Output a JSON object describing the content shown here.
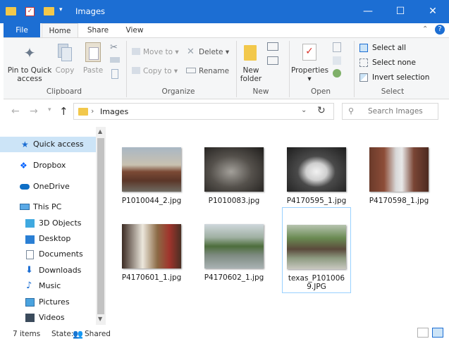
{
  "window": {
    "title": "Images"
  },
  "ribbon_tabs": [
    "File",
    "Home",
    "Share",
    "View"
  ],
  "clipboard": {
    "pin_label": "Pin to Quick access",
    "copy_label": "Copy",
    "paste_label": "Paste",
    "group_label": "Clipboard"
  },
  "organize": {
    "move_to": "Move to",
    "copy_to": "Copy to",
    "delete": "Delete",
    "rename": "Rename",
    "group_label": "Organize"
  },
  "new": {
    "new_folder": "New folder",
    "group_label": "New"
  },
  "open": {
    "properties": "Properties",
    "group_label": "Open"
  },
  "select": {
    "select_all": "Select all",
    "select_none": "Select none",
    "invert": "Invert selection",
    "group_label": "Select"
  },
  "address": {
    "path": "Images",
    "search_placeholder": "Search Images"
  },
  "sidebar": {
    "items": [
      "Quick access",
      "Dropbox",
      "OneDrive",
      "This PC",
      "3D Objects",
      "Desktop",
      "Documents",
      "Downloads",
      "Music",
      "Pictures",
      "Videos"
    ]
  },
  "files": [
    {
      "name": "P1010044_2.jpg"
    },
    {
      "name": "P1010083.jpg"
    },
    {
      "name": "P4170595_1.jpg"
    },
    {
      "name": "P4170598_1.jpg"
    },
    {
      "name": "P4170601_1.jpg"
    },
    {
      "name": "P4170602_1.jpg"
    },
    {
      "name": "texas_P1010069.JPG"
    }
  ],
  "status": {
    "count": "7 items",
    "state_label": "State:",
    "state_value": "Shared"
  },
  "colors": {
    "accent": "#1c6ed3",
    "selection": "#cce4f7",
    "folder": "#f2c84b"
  }
}
